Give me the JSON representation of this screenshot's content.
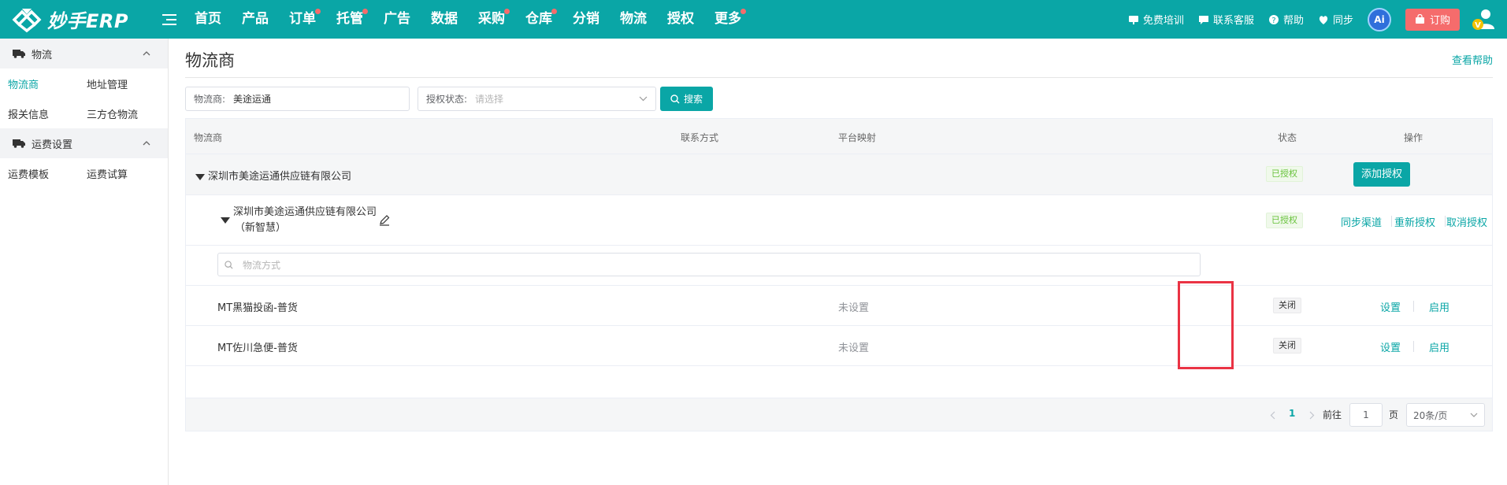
{
  "brand": {
    "name": "妙手ERP"
  },
  "nav": {
    "items": [
      {
        "label": "首页",
        "dot": false
      },
      {
        "label": "产品",
        "dot": false
      },
      {
        "label": "订单",
        "dot": true
      },
      {
        "label": "托管",
        "dot": true
      },
      {
        "label": "广告",
        "dot": false
      },
      {
        "label": "数据",
        "dot": false
      },
      {
        "label": "采购",
        "dot": true
      },
      {
        "label": "仓库",
        "dot": true
      },
      {
        "label": "分销",
        "dot": false
      },
      {
        "label": "物流",
        "dot": false
      },
      {
        "label": "授权",
        "dot": false
      },
      {
        "label": "更多",
        "dot": true
      }
    ]
  },
  "topright": {
    "training": "免费培训",
    "contact": "联系客服",
    "help": "帮助",
    "sync": "同步",
    "ai": "Ai",
    "order": "订购"
  },
  "sidebar": {
    "group1": "物流",
    "group1_links": [
      "物流商",
      "地址管理",
      "报关信息",
      "三方仓物流"
    ],
    "group2": "运费设置",
    "group2_links": [
      "运费模板",
      "运费试算"
    ]
  },
  "page": {
    "title": "物流商",
    "help": "查看帮助"
  },
  "filters": {
    "carrier_label": "物流商:",
    "carrier_value": "美途运通",
    "auth_label": "授权状态:",
    "auth_placeholder": "请选择",
    "search": "搜索"
  },
  "table": {
    "headers": {
      "carrier": "物流商",
      "contact": "联系方式",
      "mapping": "平台映射",
      "status": "状态",
      "action": "操作"
    },
    "company": {
      "name": "深圳市美途运通供应链有限公司",
      "status": "已授权",
      "add_auth": "添加授权"
    },
    "account": {
      "name_line1": "深圳市美途运通供应链有限公司",
      "name_line2": "（新智慧）",
      "status": "已授权",
      "sync": "同步渠道",
      "reauth": "重新授权",
      "cancel": "取消授权"
    },
    "method_placeholder": "物流方式",
    "methods": [
      {
        "name": "MT黑猫投函-普货",
        "mapping": "未设置",
        "status": "关闭",
        "settings": "设置",
        "enable": "启用"
      },
      {
        "name": "MT佐川急便-普货",
        "mapping": "未设置",
        "status": "关闭",
        "settings": "设置",
        "enable": "启用"
      }
    ]
  },
  "pagination": {
    "current": "1",
    "goto_label": "前往",
    "goto_value": "1",
    "page_unit": "页",
    "page_size": "20条/页"
  }
}
